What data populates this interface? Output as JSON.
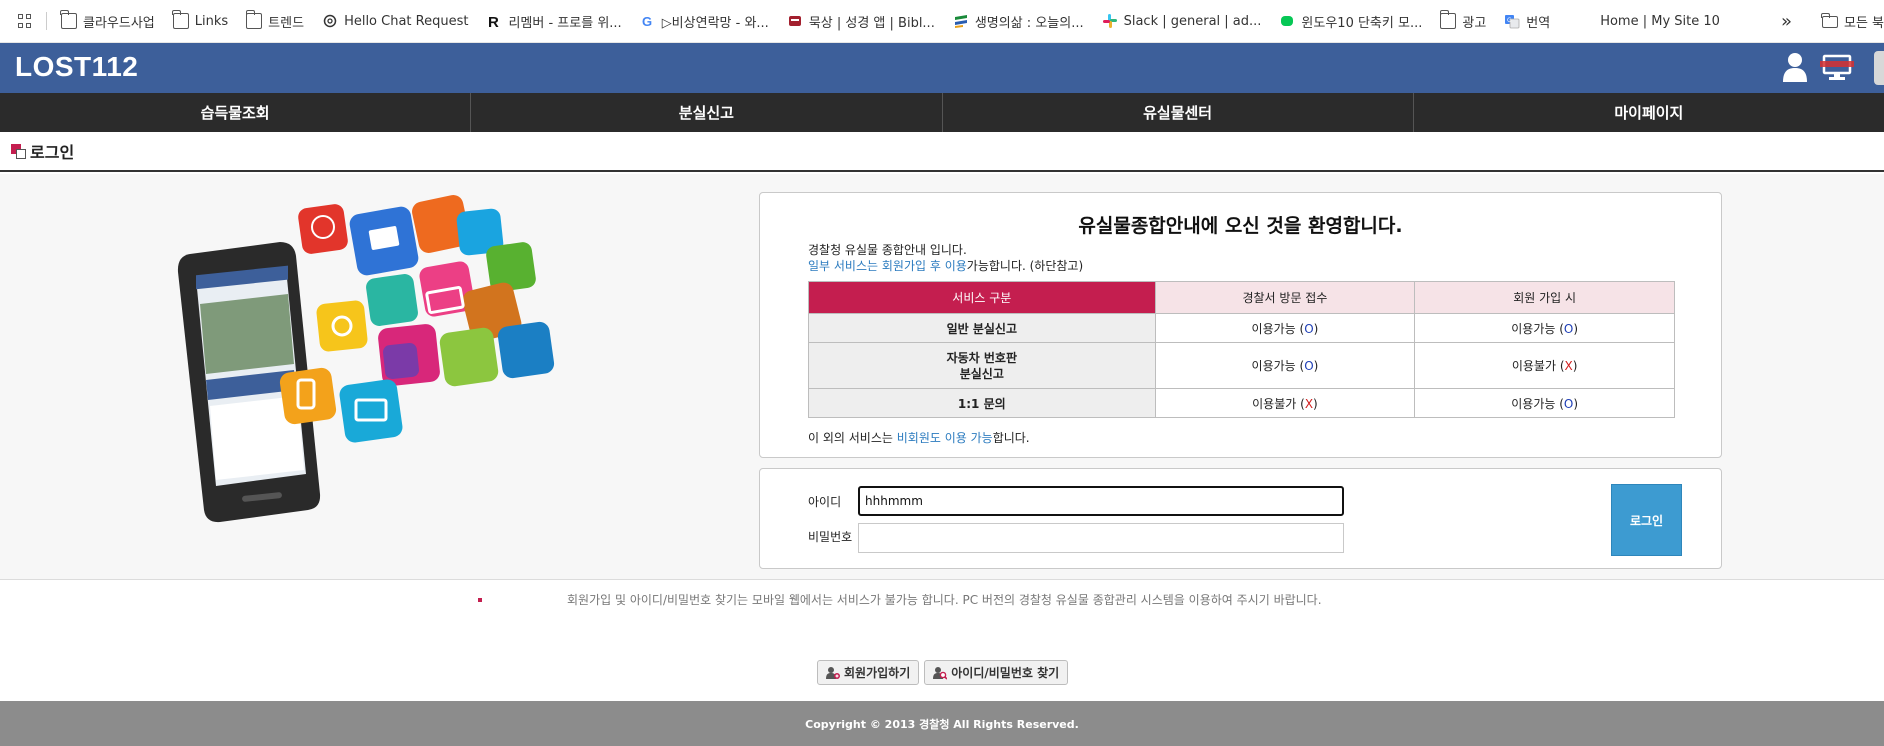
{
  "bookmarks": {
    "items": [
      {
        "label": "클라우드사업",
        "icon": "folder-icon"
      },
      {
        "label": "Links",
        "icon": "folder-icon"
      },
      {
        "label": "트렌드",
        "icon": "folder-icon"
      },
      {
        "label": "Hello Chat Request",
        "icon": "chatgpt-icon"
      },
      {
        "label": "리멤버 - 프로를 위...",
        "icon": "remember-icon"
      },
      {
        "label": "▷비상연락망 - 와...",
        "icon": "google-icon"
      },
      {
        "label": "묵상 | 성경 앱 | Bibl...",
        "icon": "bible-icon"
      },
      {
        "label": "생명의삶 : 오늘의...",
        "icon": "duranno-icon"
      },
      {
        "label": "Slack | general | ad...",
        "icon": "slack-icon"
      },
      {
        "label": "윈도우10 단축키 모...",
        "icon": "line-icon"
      },
      {
        "label": "광고",
        "icon": "folder-icon"
      },
      {
        "label": "번역",
        "icon": "translate-icon"
      },
      {
        "label": "Home | My Site 10",
        "icon": ""
      }
    ],
    "overflow_label": "»",
    "all_bookmarks_label": "모든 북"
  },
  "header": {
    "logo": "LOST112"
  },
  "nav": {
    "items": [
      "습득물조회",
      "분실신고",
      "유실물센터",
      "마이페이지"
    ]
  },
  "page": {
    "title": "로그인"
  },
  "welcome": {
    "title": "유실물종합안내에 오신 것을  환영합니다.",
    "intro_line1": "경찰청 유실물 종합안내 입니다.",
    "intro_line2_blue": "일부 서비스는 회원가입 후 이용",
    "intro_line2_rest": "가능합니다. (하단참고)",
    "table": {
      "headers": [
        "서비스 구분",
        "경찰서 방문 접수",
        "회원 가입 시"
      ],
      "rows": [
        {
          "service": "일반 분실신고",
          "visit_text": "이용가능",
          "visit_mark": "O",
          "member_text": "이용가능",
          "member_mark": "O"
        },
        {
          "service": "자동차 번호판\n분실신고",
          "visit_text": "이용가능",
          "visit_mark": "O",
          "member_text": "이용불가",
          "member_mark": "X"
        },
        {
          "service": "1:1 문의",
          "visit_text": "이용불가",
          "visit_mark": "X",
          "member_text": "이용가능",
          "member_mark": "O"
        }
      ]
    },
    "note_pre": "이 외의 서비스는 ",
    "note_blue": "비회원도 이용 가능",
    "note_post": "합니다."
  },
  "login": {
    "id_label": "아이디",
    "pw_label": "비밀번호",
    "id_value": "hhhmmm",
    "pw_value": "",
    "button_label": "로그인"
  },
  "notice": {
    "text": "회원가입 및 아이디/비밀번호 찾기는 모바일 웹에서는 서비스가 불가능 합니다. PC 버전의 경찰청 유실물 종합관리 시스템을 이용하여 주시기 바랍니다.",
    "join_button": "회원가입하기",
    "find_button": "아이디/비밀번호 찾기"
  },
  "footer": {
    "copyright": "Copyright © 2013 경찰청 All Rights Reserved."
  },
  "colors": {
    "header_bg": "#3d5f9a",
    "nav_bg": "#2b2b2b",
    "table_header_accent": "#c41e4f",
    "login_button": "#3d9bd1",
    "link_blue": "#2b7bbf",
    "footer_bg": "#8c8c8c"
  }
}
